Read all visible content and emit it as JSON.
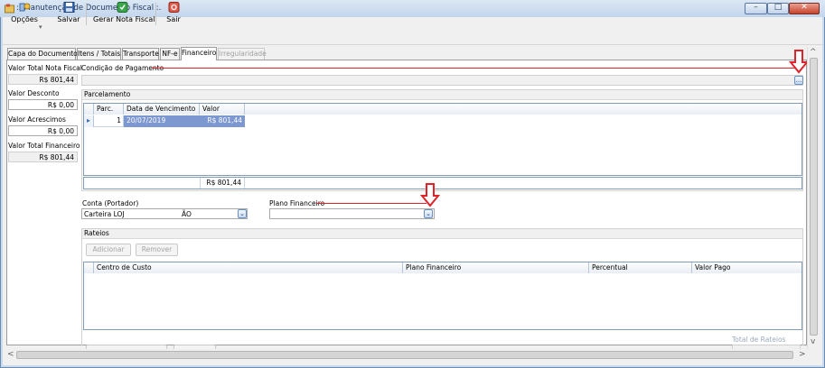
{
  "window": {
    "title": ":: Manutenção de Documento Fiscal :.",
    "controls": {
      "minimize": "–",
      "maximize": "□",
      "close": "✕"
    }
  },
  "toolbar": {
    "items": [
      {
        "label": "Opções",
        "icon": "options-icon"
      },
      {
        "label": "Salvar",
        "icon": "save-icon"
      },
      {
        "label": "Gerar Nota Fiscal",
        "icon": "generate-invoice-icon"
      },
      {
        "label": "Sair",
        "icon": "exit-icon"
      }
    ],
    "dropdown_arrow": "▾"
  },
  "tabs": [
    {
      "label": "Capa do Documento",
      "state": "normal"
    },
    {
      "label": "Itens / Totais",
      "state": "normal"
    },
    {
      "label": "Transporte",
      "state": "normal"
    },
    {
      "label": "NF-e",
      "state": "normal"
    },
    {
      "label": "Financeiro",
      "state": "active"
    },
    {
      "label": "Irregularidade",
      "state": "disabled"
    }
  ],
  "left_panel": {
    "total_nota_label": "Valor Total Nota Fiscal",
    "total_nota_value": "R$ 801,44",
    "desconto_label": "Valor Desconto",
    "desconto_value": "R$ 0,00",
    "acrescimos_label": "Valor Acrescimos",
    "acrescimos_value": "R$ 0,00",
    "total_financeiro_label": "Valor Total Financeiro",
    "total_financeiro_value": "R$ 801,44"
  },
  "condicao_pagamento": {
    "label": "Condição de Pagamento",
    "value": "",
    "button": "..."
  },
  "parcelamento": {
    "label": "Parcelamento",
    "columns": [
      "Parc.",
      "Data de Vencimento",
      "Valor"
    ],
    "rows": [
      {
        "parc": "1",
        "data": "20/07/2019",
        "valor": "R$ 801,44"
      }
    ],
    "row_indicator": "▸",
    "total": "R$ 801,44"
  },
  "conta": {
    "label": "Conta (Portador)",
    "value": "Carteira LOJ",
    "value_suffix": "ÃO"
  },
  "plano_financeiro": {
    "label": "Plano Financeiro",
    "value": ""
  },
  "rateios": {
    "label": "Rateios",
    "add_button": "Adicionar",
    "remove_button": "Remover",
    "columns": [
      "Centro de Custo",
      "Plano Financeiro",
      "Percentual",
      "Valor Pago"
    ],
    "total_label": "Total de Rateios"
  },
  "annotations": {
    "arrow_color": "#e0232b"
  },
  "scroll": {
    "up": "^",
    "down": "v",
    "left": "<",
    "right": ">"
  }
}
